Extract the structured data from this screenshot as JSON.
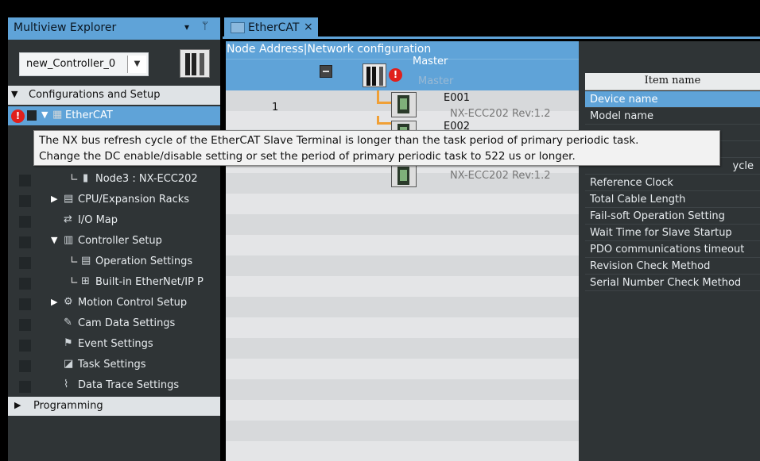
{
  "explorer": {
    "title": "Multiview Explorer",
    "pin_glyph": "▾",
    "pin2_glyph": "ᛘ",
    "controller_select": "new_Controller_0",
    "tree": {
      "configurations": "Configurations and Setup",
      "ethercat": "EtherCAT",
      "node3": "Node3 : NX-ECC202",
      "cpu_racks": "CPU/Expansion Racks",
      "io_map": "I/O Map",
      "controller_setup": "Controller Setup",
      "operation_settings": "Operation Settings",
      "builtin_ethernet": "Built-in EtherNet/IP P",
      "motion_control": "Motion Control Setup",
      "cam_data": "Cam Data Settings",
      "event_settings": "Event Settings",
      "task_settings": "Task Settings",
      "data_trace": "Data Trace Settings",
      "programming": "Programming"
    }
  },
  "tab": {
    "label": "EtherCAT",
    "close": "×"
  },
  "network": {
    "header": "Node Address|Network configuration",
    "master_label": "Master",
    "master_sublabel": "Master",
    "node_number": "1",
    "devices": [
      {
        "name": "E001",
        "model": "NX-ECC202 Rev:1.2"
      },
      {
        "name": "E002",
        "model": ""
      },
      {
        "name": "",
        "model": "NX-ECC202 Rev:1.2"
      }
    ]
  },
  "properties": {
    "header": "Item name",
    "items": [
      "Device name",
      "Model name",
      "ycle",
      "Reference Clock",
      "Total Cable Length",
      "Fail-soft Operation Setting",
      "Wait Time for Slave Startup",
      "PDO communications timeout",
      "Revision Check Method",
      "Serial Number Check Method"
    ]
  },
  "tooltip": {
    "line1": "The NX bus refresh cycle of the EtherCAT Slave Terminal is longer than the task period of primary periodic task.",
    "line2": "Change the DC enable/disable setting or set the period of primary periodic task to 522 us or longer."
  },
  "colors": {
    "accent": "#5fa3d8",
    "warning": "#e0201c",
    "connector": "#f0a036"
  }
}
